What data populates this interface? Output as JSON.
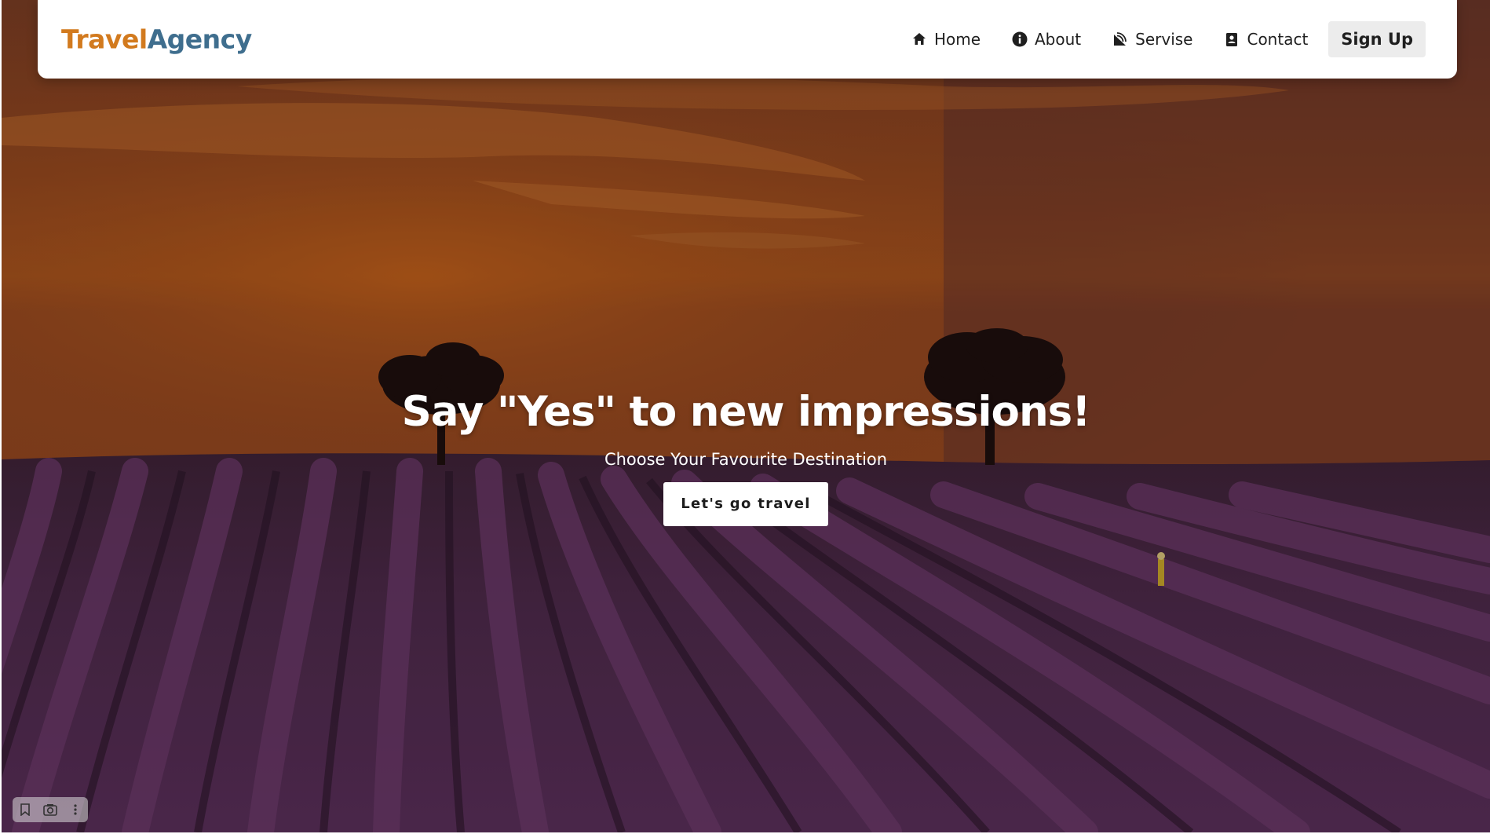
{
  "brand": {
    "part1": "Travel",
    "part2": "Agency"
  },
  "nav": {
    "items": [
      {
        "label": "Home",
        "icon": "home-icon"
      },
      {
        "label": "About",
        "icon": "info-icon"
      },
      {
        "label": "Servise",
        "icon": "satellite-dish-icon"
      },
      {
        "label": "Contact",
        "icon": "address-book-icon"
      }
    ],
    "signup_label": "Sign Up"
  },
  "hero": {
    "headline": "Say \"Yes\" to new impressions!",
    "subline": "Choose Your Favourite Destination",
    "cta_label": "Let's go travel"
  },
  "mini_toolbar": {
    "icons": [
      "bookmark-icon",
      "camera-icon",
      "more-vertical-icon"
    ]
  },
  "colors": {
    "brand_orange": "#d27a1e",
    "brand_blue": "#3f6e8e",
    "sky": "#b8561a",
    "lavender": "#5b2f5c"
  }
}
